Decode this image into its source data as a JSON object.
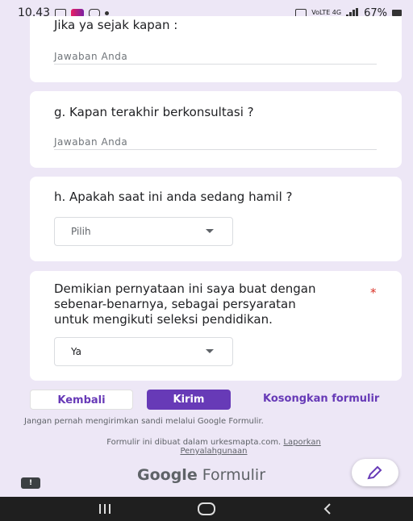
{
  "status_bar": {
    "time": "10.43",
    "network_small": "VoLTE 4G",
    "battery": "67%"
  },
  "questions": {
    "f_since_label": "Jika ya sejak kapan :",
    "f_answer_placeholder": "Jawaban Anda",
    "g_label": "g. Kapan terakhir berkonsultasi ?",
    "g_answer_placeholder": "Jawaban Anda",
    "h_label": "h. Apakah saat ini anda sedang hamil ?",
    "h_select_value": "Pilih",
    "statement_line1": "Demikian pernyataan ini saya buat dengan",
    "statement_line2": "sebenar-benarnya, sebagai persyaratan",
    "statement_line3": "untuk mengikuti seleksi pendidikan.",
    "statement_required": "*",
    "statement_select_value": "Ya"
  },
  "actions": {
    "back_label": "Kembali",
    "submit_label": "Kirim",
    "clear_label": "Kosongkan formulir"
  },
  "footer": {
    "warning": "Jangan pernah mengirimkan sandi melalui Google Formulir.",
    "made_text": "Formulir ini dibuat dalam urkesmapta.com.",
    "report_line1": "Laporkan",
    "report_line2": "Penyalahgunaan",
    "brand_bold": "Google",
    "brand_rest": "Formulir"
  },
  "icons": {
    "edit": "pencil-icon",
    "report": "exclamation-icon",
    "nav_recents": "recents-icon",
    "nav_home": "home-icon",
    "nav_back": "back-icon"
  },
  "colors": {
    "background": "#ede7f6",
    "accent": "#673ab7",
    "required": "#d93025"
  }
}
